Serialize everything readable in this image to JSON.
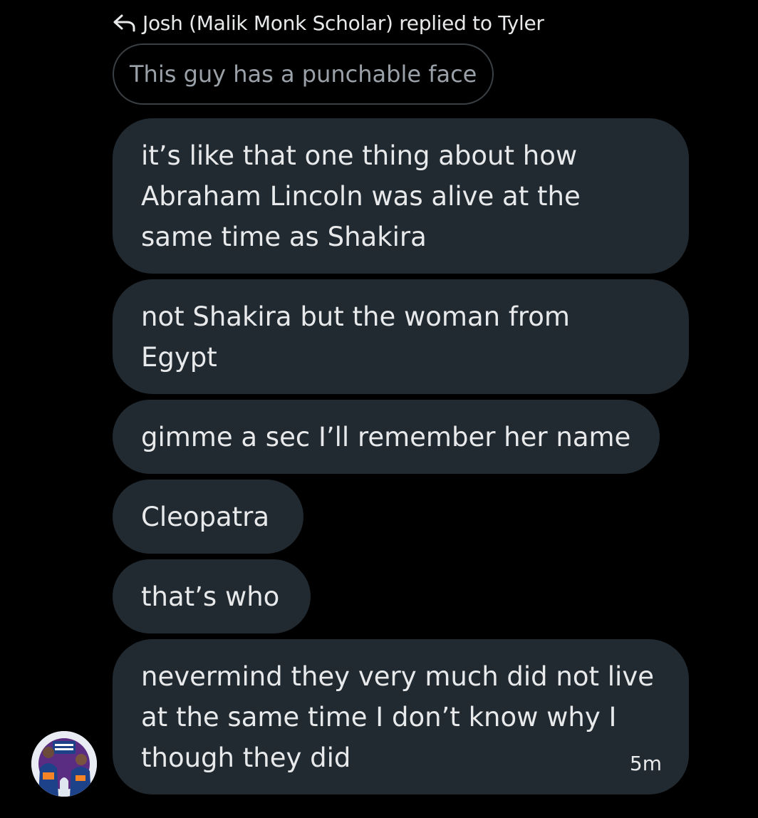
{
  "reply_header": {
    "text": "Josh (Malik Monk Scholar) replied to Tyler",
    "icon": "reply-arrow-icon"
  },
  "quoted_message": {
    "text": "This guy has a punchable face"
  },
  "messages": [
    {
      "text": "it’s like that one thing about how Abraham Lincoln was alive at the same time as Shakira"
    },
    {
      "text": "not Shakira but the woman from Egypt"
    },
    {
      "text": "gimme a sec I’ll remember her name"
    },
    {
      "text": "Cleopatra"
    },
    {
      "text": "that’s who"
    },
    {
      "text": "nevermind they very much did not live at the same time I don’t know why I though they did",
      "timestamp": "5m"
    }
  ],
  "avatar": {
    "icon": "user-avatar-icon"
  },
  "colors": {
    "background": "#000000",
    "bubble": "#222a31",
    "text": "#e7e9ea",
    "quoted_border": "#3a3f44",
    "quoted_text": "#9aa1a8"
  }
}
